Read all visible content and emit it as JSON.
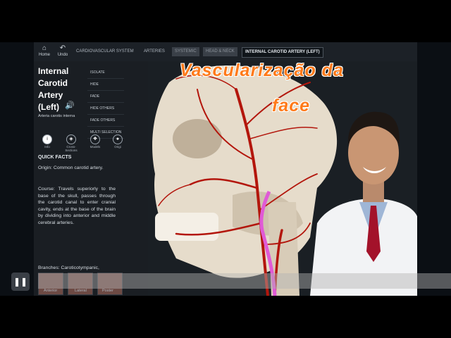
{
  "toolbar": {
    "home_label": "Home",
    "undo_label": "Undo",
    "breadcrumbs": [
      {
        "label": "CARDIOVASCULAR SYSTEM"
      },
      {
        "label": "ARTERIES"
      },
      {
        "label": "SYSTEMIC"
      },
      {
        "label": "HEAD & NECK"
      },
      {
        "label": "INTERNAL CAROTID ARTERY (LEFT)"
      }
    ]
  },
  "sidebar": {
    "title_lines": [
      "Internal",
      "Carotid",
      "Artery",
      "(Left)"
    ],
    "latin_name": "Arteria carotis interna",
    "actions": [
      "ISOLATE",
      "HIDE",
      "FADE",
      "HIDE OTHERS",
      "FADE OTHERS",
      "MULTI SELECTION"
    ],
    "tabs": [
      "Info",
      "Cross-Sections",
      "Models",
      "Origi"
    ],
    "quick_facts_heading": "QUICK FACTS",
    "origin_text": "Origin: Common carotid artery.",
    "course_text": "Course: Travels superiorly to the base of the skull, passes through the carotid canal to enter cranial cavity, ends at the base of the brain by dividing into anterior and middle cerebral arteries.",
    "branches_text": "Branches: Caroticotympanic,",
    "thumb_labels": [
      "Anterior",
      "Lateral",
      "Poster"
    ]
  },
  "overlay": {
    "title_line1": "Vascularização da",
    "title_line2": "face"
  },
  "colors": {
    "accent_orange": "#ff7a1a",
    "artery_red": "#b3160c",
    "carotid_highlight": "#e05ad6",
    "panel_dark": "#1a1e23"
  },
  "icons": [
    "home-icon",
    "undo-icon",
    "speaker-icon",
    "info-icon",
    "cross-sections-icon",
    "models-icon",
    "pause-icon"
  ]
}
